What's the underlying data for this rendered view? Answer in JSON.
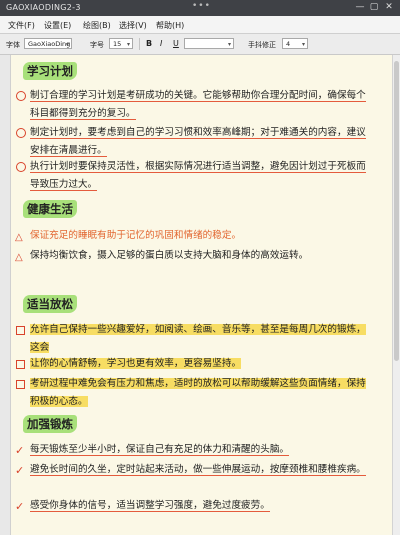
{
  "window": {
    "title": "GAOXIAODING2-3",
    "dots": "•••",
    "minimize": "—",
    "maximize": "▢",
    "close": "✕"
  },
  "menu": [
    "文件(F)",
    "设置(E)",
    "绘图(B)",
    "选择(V)",
    "帮助(H)"
  ],
  "toolbar": {
    "font_label": "字体",
    "font_value": "GaoXiaoDing",
    "size_label": "字号",
    "size_value": "15",
    "bold": "B",
    "italic": "I",
    "underline": "U",
    "color_value": "",
    "handwriting_label": "手抖修正",
    "handwriting_value": "4"
  },
  "sections": [
    {
      "title": "学习计划",
      "items": [
        {
          "text": "制订合理的学习计划是考研成功的关键。它能够帮助你合理分配时间，确保每个科目都得到充分的复习。",
          "marker": "circle"
        },
        {
          "text": "制定计划时，要考虑到自己的学习习惯和效率高峰期；对于难通关的内容，建议安排在清晨进行。",
          "marker": "circle"
        },
        {
          "text": "执行计划时要保持灵活性，根据实际情况进行适当调整，避免因计划过于死板而导致压力过大。",
          "marker": "circle"
        }
      ]
    },
    {
      "title": "健康生活",
      "items": [
        {
          "text": "保证充足的睡眠有助于记忆的巩固和情绪的稳定。",
          "marker": "triangle",
          "hoop": "睡眠"
        },
        {
          "text": "保持均衡饮食，摄入足够的蛋白质以支持大脑和身体的高效运转。",
          "marker": "triangle",
          "hoop": "蛋白质"
        }
      ]
    },
    {
      "title": "适当放松",
      "items": [
        {
          "text": "允许自己保持一些兴趣爱好，如阅读、绘画、音乐等，甚至是每周几次的锻炼，这会",
          "marker": "square"
        },
        {
          "text": "让你的心情舒畅，学习也更有效率，更容易坚持。",
          "marker": "square"
        },
        {
          "text": "考研过程中难免会有压力和焦虑，适时的放松可以帮助缓解这些负面情绪，保持积极的心态。",
          "marker": "square"
        }
      ]
    },
    {
      "title": "加强锻炼",
      "items": [
        {
          "text": "每天锻炼至少半小时，保证自己有充足的体力和清醒的头脑。",
          "marker": "check"
        },
        {
          "text": "避免长时间的久坐，定时站起来活动，做一些伸展运动，按摩颈椎和腰椎疾病。",
          "marker": "check"
        },
        {
          "text": "感受你身体的信号，适当调整学习强度，避免过度疲劳。",
          "marker": "check"
        }
      ]
    }
  ],
  "colors": {
    "heading_highlight": "#a8e07a",
    "underline_red": "#e45b3c",
    "highlight_yellow": "#f7dd63",
    "marker_red": "#d9432b",
    "paper": "#fbf8e6"
  }
}
